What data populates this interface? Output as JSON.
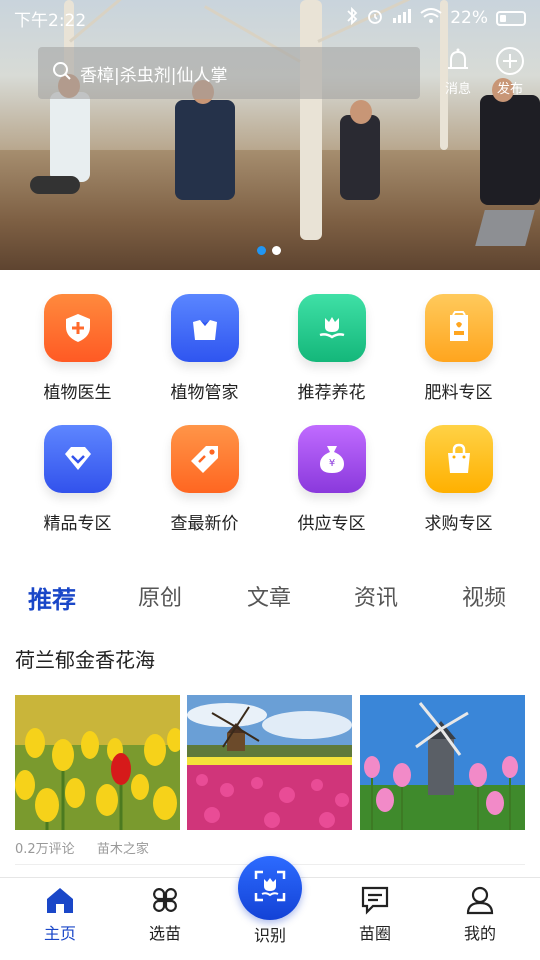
{
  "status": {
    "time": "下午2:22",
    "battery": "22%"
  },
  "search": {
    "placeholder": "香樟|杀虫剂|仙人掌"
  },
  "header": {
    "message_label": "消息",
    "publish_label": "发布"
  },
  "carousel": {
    "count": 2,
    "active": 0
  },
  "grid": [
    {
      "label": "植物医生",
      "icon": "shield-plus-icon",
      "color": "#ff6d2e"
    },
    {
      "label": "植物管家",
      "icon": "butler-icon",
      "color": "#3d6cff"
    },
    {
      "label": "推荐养花",
      "icon": "flower-icon",
      "color": "#22c98e"
    },
    {
      "label": "肥料专区",
      "icon": "fertilizer-bag-icon",
      "color": "#ffb836"
    },
    {
      "label": "精品专区",
      "icon": "diamond-icon",
      "color": "#4a6cff"
    },
    {
      "label": "查最新价",
      "icon": "price-tag-icon",
      "color": "#ff7a2b"
    },
    {
      "label": "供应专区",
      "icon": "money-bag-icon",
      "color": "#a24ee8"
    },
    {
      "label": "求购专区",
      "icon": "shopping-bag-icon",
      "color": "#ffc325"
    }
  ],
  "tabs": [
    {
      "label": "推荐",
      "active": true
    },
    {
      "label": "原创",
      "active": false
    },
    {
      "label": "文章",
      "active": false
    },
    {
      "label": "资讯",
      "active": false
    },
    {
      "label": "视频",
      "active": false
    }
  ],
  "article": {
    "title": "荷兰郁金香花海",
    "comments": "0.2万评论",
    "source": "苗木之家"
  },
  "bottom_nav": [
    {
      "label": "主页",
      "icon": "home-icon",
      "active": true
    },
    {
      "label": "选苗",
      "icon": "clover-grid-icon",
      "active": false
    },
    {
      "label": "识别",
      "icon": "scan-flower-icon",
      "active": false
    },
    {
      "label": "苗圈",
      "icon": "chat-icon",
      "active": false
    },
    {
      "label": "我的",
      "icon": "user-icon",
      "active": false
    }
  ]
}
